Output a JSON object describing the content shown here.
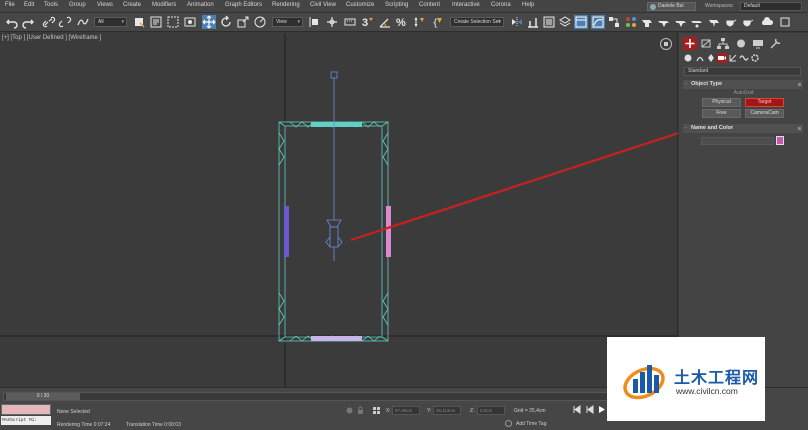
{
  "menubar": {
    "items": [
      "File",
      "Edit",
      "Tools",
      "Group",
      "Views",
      "Create",
      "Modifiers",
      "Animation",
      "Graph Editors",
      "Rendering",
      "Civil View",
      "Customize",
      "Scripting",
      "Content",
      "Interactive",
      "Corona",
      "Help"
    ],
    "user": "Daniele Bal",
    "workspace_label": "Workspaces:",
    "workspace_value": "Default"
  },
  "toolbar": {
    "filter_value": "All",
    "view_value": "View",
    "selection_set_placeholder": "Create Selection Set",
    "snap_label": "3"
  },
  "viewport": {
    "label": "[+] [Top ] [User Defined ] [Wireframe ]"
  },
  "command_panel": {
    "category_value": "Standard",
    "object_type_title": "Object Type",
    "autogrid_label": "AutoGrid",
    "buttons": [
      "Physical",
      "Target",
      "Free",
      "CameraCam"
    ],
    "selected_button": "Target",
    "name_color_title": "Name and Color",
    "color": "#c85ab0"
  },
  "bottom": {
    "time_value": "0 / 30",
    "script_text": "MAXScript Mi:",
    "status": "None Selected",
    "render_time": "Rendering Time  0:07:24",
    "translation_time": "Translation Time  0:00:03",
    "x_label": "X:",
    "y_label": "Y:",
    "z_label": "Z:",
    "x_value": "67,48cm",
    "y_value": "26,113cm",
    "z_value": "0,0cm",
    "grid": "Grid = 25,4cm",
    "add_time_tag": "Add Time Tag"
  },
  "watermark": {
    "title": "土木工程网",
    "url": "www.civilcn.com",
    "colors": {
      "blue": "#1a5aa8",
      "orange": "#f08c1e"
    }
  },
  "colors": {
    "accent_blue": "#4d7fb3",
    "accent_red": "#a51d1d",
    "wire_cyan": "#62d0c4",
    "annotation_red": "#c62020"
  }
}
